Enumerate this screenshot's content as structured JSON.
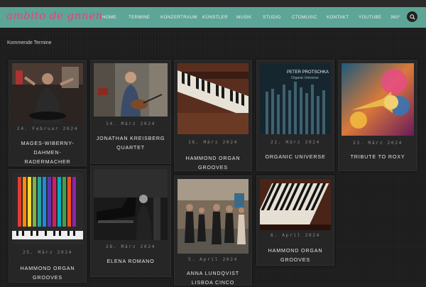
{
  "header": {
    "logo": "ambito de gnnen",
    "nav": [
      "HOME",
      "TERMINE",
      "KONZERTRAUM",
      "KÜNSTLER",
      "MUSIK",
      "STUDIO",
      "CTOMUSIC",
      "KONTAKT",
      "YOUTUBE",
      "360°"
    ],
    "search_icon": "search-icon"
  },
  "section": {
    "title": "Kommende Termine"
  },
  "events": [
    {
      "date": "24. Februar 2024",
      "title": "MAGES-WIBERNY-DAHMEN-RADERMACHER",
      "image": "band-photo"
    },
    {
      "date": "14. März 2024",
      "title": "JONATHAN KREISBERG QUARTET",
      "image": "guitarist-photo"
    },
    {
      "date": "16. März 2024",
      "title": "HAMMOND ORGAN GROOVES",
      "image": "organ-keys-photo"
    },
    {
      "date": "21. März 2024",
      "title": "ORGANIC UNIVERSE",
      "image": "album-cover",
      "cover_artist": "PETER PROTSCHKA",
      "cover_title": "Organic Universe"
    },
    {
      "date": "23. März 2024",
      "title": "TRIBUTE TO ROXY",
      "image": "trumpet-art"
    },
    {
      "date": "25. März 2024",
      "title": "HAMMOND ORGAN GROOVES",
      "image": "colorful-organ-art"
    },
    {
      "date": "28. März 2024",
      "title": "ELENA ROMANO",
      "image": "singer-piano-photo"
    },
    {
      "date": "5. April 2024",
      "title": "ANNA LUNDQVIST LISBOA CINCO",
      "image": "band-street-photo"
    },
    {
      "date": "6. April 2024",
      "title": "HAMMOND ORGAN GROOVES",
      "image": "organ-keys-photo"
    }
  ],
  "colors": {
    "nav_bg": "#5da596",
    "logo": "#e3447a",
    "page_bg": "#1e1e1e"
  }
}
